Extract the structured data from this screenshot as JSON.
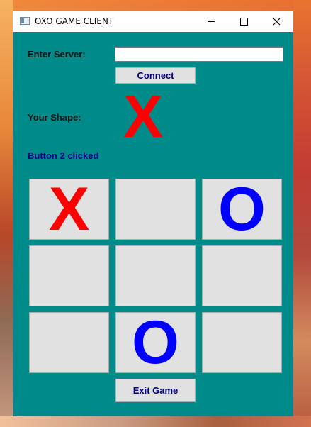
{
  "window": {
    "title": "OXO GAME CLIENT"
  },
  "server": {
    "label": "Enter Server:",
    "value": "",
    "connect_label": "Connect"
  },
  "shape": {
    "label": "Your Shape:",
    "mark": "X",
    "mark_color": "#ff0000"
  },
  "status": {
    "text": "Button 2 clicked"
  },
  "board": {
    "cells": [
      "X",
      "",
      "O",
      "",
      "",
      "",
      "",
      "O",
      ""
    ],
    "x_color": "#ff0000",
    "o_color": "#0000ff"
  },
  "exit": {
    "label": "Exit Game"
  },
  "colors": {
    "client_bg": "#008b8b",
    "button_text": "#000080",
    "status_text": "#00008b"
  }
}
